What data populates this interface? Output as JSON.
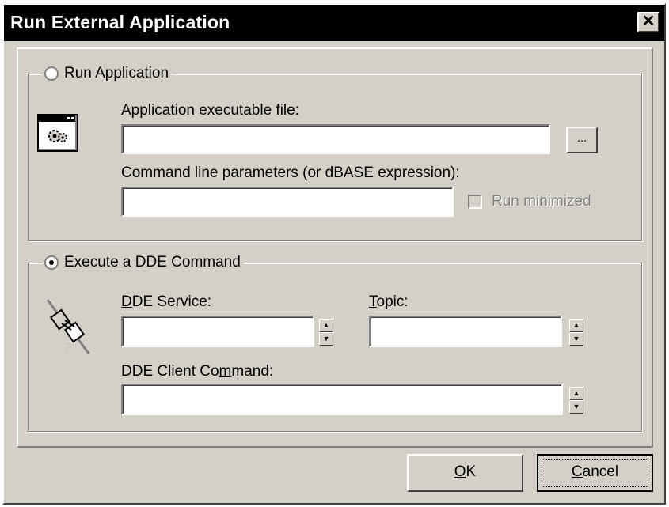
{
  "window": {
    "title": "Run External Application",
    "close_glyph": "✕"
  },
  "run_app": {
    "radio_label": "Run Application",
    "exe_label": "Application executable file:",
    "exe_value": "",
    "browse_label": "...",
    "params_label": "Command line parameters (or dBASE expression):",
    "params_value": "",
    "minimized_label": "Run minimized",
    "icon": "application-gear-icon"
  },
  "dde": {
    "radio_label": "Execute a DDE Command",
    "service_label": {
      "accel": "D",
      "rest": "DE Service:"
    },
    "service_value": "",
    "topic_label": {
      "accel": "T",
      "rest": "opic:"
    },
    "topic_value": "",
    "client_label": {
      "pre": "DDE Client Co",
      "accel": "m",
      "rest": "mand:"
    },
    "client_value": "",
    "icon": "dde-connector-icon"
  },
  "buttons": {
    "ok": {
      "accel": "O",
      "rest": "K"
    },
    "cancel": {
      "accel": "C",
      "rest": "ancel"
    }
  }
}
